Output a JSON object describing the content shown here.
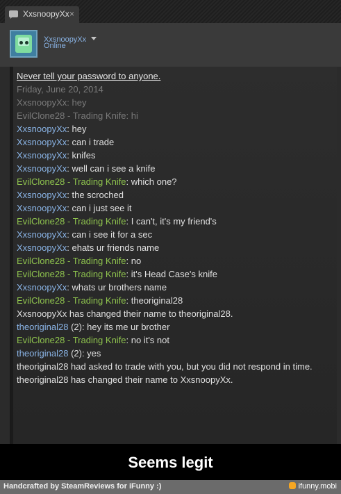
{
  "tab": {
    "title": "XxsnoopyXx",
    "close": "×"
  },
  "header": {
    "username": "XxsnoopyXx",
    "status": "Online"
  },
  "messages": [
    {
      "parts": [
        {
          "text": "Never tell your password to anyone.",
          "style": "warn"
        }
      ]
    },
    {
      "parts": [
        {
          "text": "Friday, June 20, 2014",
          "style": "gray"
        }
      ]
    },
    {
      "parts": [
        {
          "text": "XxsnoopyXx: hey",
          "style": "gray"
        }
      ]
    },
    {
      "parts": [
        {
          "text": "EvilClone28 - Trading Knife: hi",
          "style": "gray"
        }
      ]
    },
    {
      "parts": [
        {
          "text": "XxsnoopyXx",
          "style": "blue"
        },
        {
          "text": ": hey",
          "style": "white"
        }
      ]
    },
    {
      "parts": [
        {
          "text": "XxsnoopyXx",
          "style": "blue"
        },
        {
          "text": ": can i trade",
          "style": "white"
        }
      ]
    },
    {
      "parts": [
        {
          "text": "XxsnoopyXx",
          "style": "blue"
        },
        {
          "text": ": knifes",
          "style": "white"
        }
      ]
    },
    {
      "parts": [
        {
          "text": "XxsnoopyXx",
          "style": "blue"
        },
        {
          "text": ": well can i see a knife",
          "style": "white"
        }
      ]
    },
    {
      "parts": [
        {
          "text": "EvilClone28 - Trading Knife",
          "style": "green"
        },
        {
          "text": ": which one?",
          "style": "white"
        }
      ]
    },
    {
      "parts": [
        {
          "text": "XxsnoopyXx",
          "style": "blue"
        },
        {
          "text": ": the scroched",
          "style": "white"
        }
      ]
    },
    {
      "parts": [
        {
          "text": "XxsnoopyXx",
          "style": "blue"
        },
        {
          "text": ": can i just see it",
          "style": "white"
        }
      ]
    },
    {
      "parts": [
        {
          "text": "EvilClone28 - Trading Knife",
          "style": "green"
        },
        {
          "text": ": I can't, it's my friend's",
          "style": "white"
        }
      ]
    },
    {
      "parts": [
        {
          "text": "XxsnoopyXx",
          "style": "blue"
        },
        {
          "text": ": can i see it for a sec",
          "style": "white"
        }
      ]
    },
    {
      "parts": [
        {
          "text": "XxsnoopyXx",
          "style": "blue"
        },
        {
          "text": ": ehats ur friends name",
          "style": "white"
        }
      ]
    },
    {
      "parts": [
        {
          "text": "EvilClone28 - Trading Knife",
          "style": "green"
        },
        {
          "text": ": no",
          "style": "white"
        }
      ]
    },
    {
      "parts": [
        {
          "text": "EvilClone28 - Trading Knife",
          "style": "green"
        },
        {
          "text": ": it's Head Case's knife",
          "style": "white"
        }
      ]
    },
    {
      "parts": [
        {
          "text": "XxsnoopyXx",
          "style": "blue"
        },
        {
          "text": ": whats ur brothers name",
          "style": "white"
        }
      ]
    },
    {
      "parts": [
        {
          "text": "EvilClone28 - Trading Knife",
          "style": "green"
        },
        {
          "text": ": theoriginal28",
          "style": "white"
        }
      ]
    },
    {
      "parts": [
        {
          "text": "XxsnoopyXx has changed their name to theoriginal28.",
          "style": "white"
        }
      ]
    },
    {
      "parts": [
        {
          "text": "theoriginal28",
          "style": "blue"
        },
        {
          "text": " (2): hey its me ur brother",
          "style": "white"
        }
      ]
    },
    {
      "parts": [
        {
          "text": "EvilClone28 - Trading Knife",
          "style": "green"
        },
        {
          "text": ": no it's not",
          "style": "white"
        }
      ]
    },
    {
      "parts": [
        {
          "text": "theoriginal28",
          "style": "blue"
        },
        {
          "text": " (2): yes",
          "style": "white"
        }
      ]
    },
    {
      "parts": [
        {
          "text": "theoriginal28 had asked to trade with you, but you did not respond in time.",
          "style": "white"
        }
      ]
    },
    {
      "parts": [
        {
          "text": "theoriginal28 has changed their name to XxsnoopyXx.",
          "style": "white"
        }
      ]
    }
  ],
  "caption": "Seems legit",
  "footer": {
    "credit": "Handcrafted by SteamReviews for iFunny :)",
    "watermark": "ifunny.mobi"
  },
  "colors": {
    "blue_name": "#8ab4e6",
    "green_name": "#8fc44e",
    "gray_text": "#7a7a7a",
    "window_bg": "#2b2b2b"
  },
  "icons": {
    "tab": "chat-bubble-icon",
    "dropdown": "chevron-down-icon",
    "watermark": "ifunny-smile-icon"
  }
}
